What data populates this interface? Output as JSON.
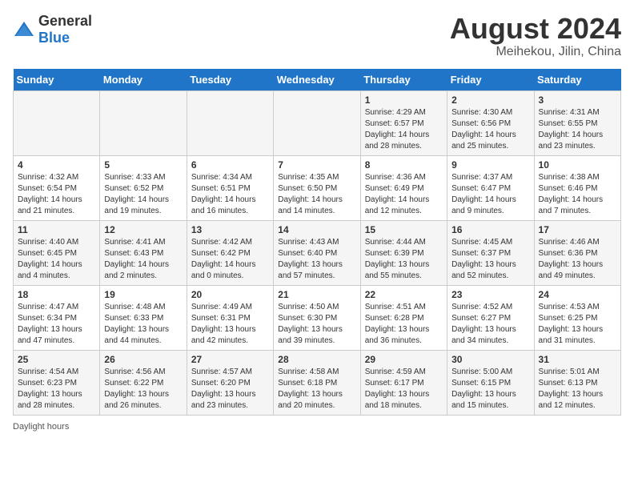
{
  "header": {
    "logo_general": "General",
    "logo_blue": "Blue",
    "month_title": "August 2024",
    "location": "Meihekou, Jilin, China"
  },
  "days_of_week": [
    "Sunday",
    "Monday",
    "Tuesday",
    "Wednesday",
    "Thursday",
    "Friday",
    "Saturday"
  ],
  "weeks": [
    [
      {
        "day": "",
        "info": ""
      },
      {
        "day": "",
        "info": ""
      },
      {
        "day": "",
        "info": ""
      },
      {
        "day": "",
        "info": ""
      },
      {
        "day": "1",
        "info": "Sunrise: 4:29 AM\nSunset: 6:57 PM\nDaylight: 14 hours\nand 28 minutes."
      },
      {
        "day": "2",
        "info": "Sunrise: 4:30 AM\nSunset: 6:56 PM\nDaylight: 14 hours\nand 25 minutes."
      },
      {
        "day": "3",
        "info": "Sunrise: 4:31 AM\nSunset: 6:55 PM\nDaylight: 14 hours\nand 23 minutes."
      }
    ],
    [
      {
        "day": "4",
        "info": "Sunrise: 4:32 AM\nSunset: 6:54 PM\nDaylight: 14 hours\nand 21 minutes."
      },
      {
        "day": "5",
        "info": "Sunrise: 4:33 AM\nSunset: 6:52 PM\nDaylight: 14 hours\nand 19 minutes."
      },
      {
        "day": "6",
        "info": "Sunrise: 4:34 AM\nSunset: 6:51 PM\nDaylight: 14 hours\nand 16 minutes."
      },
      {
        "day": "7",
        "info": "Sunrise: 4:35 AM\nSunset: 6:50 PM\nDaylight: 14 hours\nand 14 minutes."
      },
      {
        "day": "8",
        "info": "Sunrise: 4:36 AM\nSunset: 6:49 PM\nDaylight: 14 hours\nand 12 minutes."
      },
      {
        "day": "9",
        "info": "Sunrise: 4:37 AM\nSunset: 6:47 PM\nDaylight: 14 hours\nand 9 minutes."
      },
      {
        "day": "10",
        "info": "Sunrise: 4:38 AM\nSunset: 6:46 PM\nDaylight: 14 hours\nand 7 minutes."
      }
    ],
    [
      {
        "day": "11",
        "info": "Sunrise: 4:40 AM\nSunset: 6:45 PM\nDaylight: 14 hours\nand 4 minutes."
      },
      {
        "day": "12",
        "info": "Sunrise: 4:41 AM\nSunset: 6:43 PM\nDaylight: 14 hours\nand 2 minutes."
      },
      {
        "day": "13",
        "info": "Sunrise: 4:42 AM\nSunset: 6:42 PM\nDaylight: 14 hours\nand 0 minutes."
      },
      {
        "day": "14",
        "info": "Sunrise: 4:43 AM\nSunset: 6:40 PM\nDaylight: 13 hours\nand 57 minutes."
      },
      {
        "day": "15",
        "info": "Sunrise: 4:44 AM\nSunset: 6:39 PM\nDaylight: 13 hours\nand 55 minutes."
      },
      {
        "day": "16",
        "info": "Sunrise: 4:45 AM\nSunset: 6:37 PM\nDaylight: 13 hours\nand 52 minutes."
      },
      {
        "day": "17",
        "info": "Sunrise: 4:46 AM\nSunset: 6:36 PM\nDaylight: 13 hours\nand 49 minutes."
      }
    ],
    [
      {
        "day": "18",
        "info": "Sunrise: 4:47 AM\nSunset: 6:34 PM\nDaylight: 13 hours\nand 47 minutes."
      },
      {
        "day": "19",
        "info": "Sunrise: 4:48 AM\nSunset: 6:33 PM\nDaylight: 13 hours\nand 44 minutes."
      },
      {
        "day": "20",
        "info": "Sunrise: 4:49 AM\nSunset: 6:31 PM\nDaylight: 13 hours\nand 42 minutes."
      },
      {
        "day": "21",
        "info": "Sunrise: 4:50 AM\nSunset: 6:30 PM\nDaylight: 13 hours\nand 39 minutes."
      },
      {
        "day": "22",
        "info": "Sunrise: 4:51 AM\nSunset: 6:28 PM\nDaylight: 13 hours\nand 36 minutes."
      },
      {
        "day": "23",
        "info": "Sunrise: 4:52 AM\nSunset: 6:27 PM\nDaylight: 13 hours\nand 34 minutes."
      },
      {
        "day": "24",
        "info": "Sunrise: 4:53 AM\nSunset: 6:25 PM\nDaylight: 13 hours\nand 31 minutes."
      }
    ],
    [
      {
        "day": "25",
        "info": "Sunrise: 4:54 AM\nSunset: 6:23 PM\nDaylight: 13 hours\nand 28 minutes."
      },
      {
        "day": "26",
        "info": "Sunrise: 4:56 AM\nSunset: 6:22 PM\nDaylight: 13 hours\nand 26 minutes."
      },
      {
        "day": "27",
        "info": "Sunrise: 4:57 AM\nSunset: 6:20 PM\nDaylight: 13 hours\nand 23 minutes."
      },
      {
        "day": "28",
        "info": "Sunrise: 4:58 AM\nSunset: 6:18 PM\nDaylight: 13 hours\nand 20 minutes."
      },
      {
        "day": "29",
        "info": "Sunrise: 4:59 AM\nSunset: 6:17 PM\nDaylight: 13 hours\nand 18 minutes."
      },
      {
        "day": "30",
        "info": "Sunrise: 5:00 AM\nSunset: 6:15 PM\nDaylight: 13 hours\nand 15 minutes."
      },
      {
        "day": "31",
        "info": "Sunrise: 5:01 AM\nSunset: 6:13 PM\nDaylight: 13 hours\nand 12 minutes."
      }
    ]
  ],
  "footer": {
    "daylight_label": "Daylight hours"
  }
}
